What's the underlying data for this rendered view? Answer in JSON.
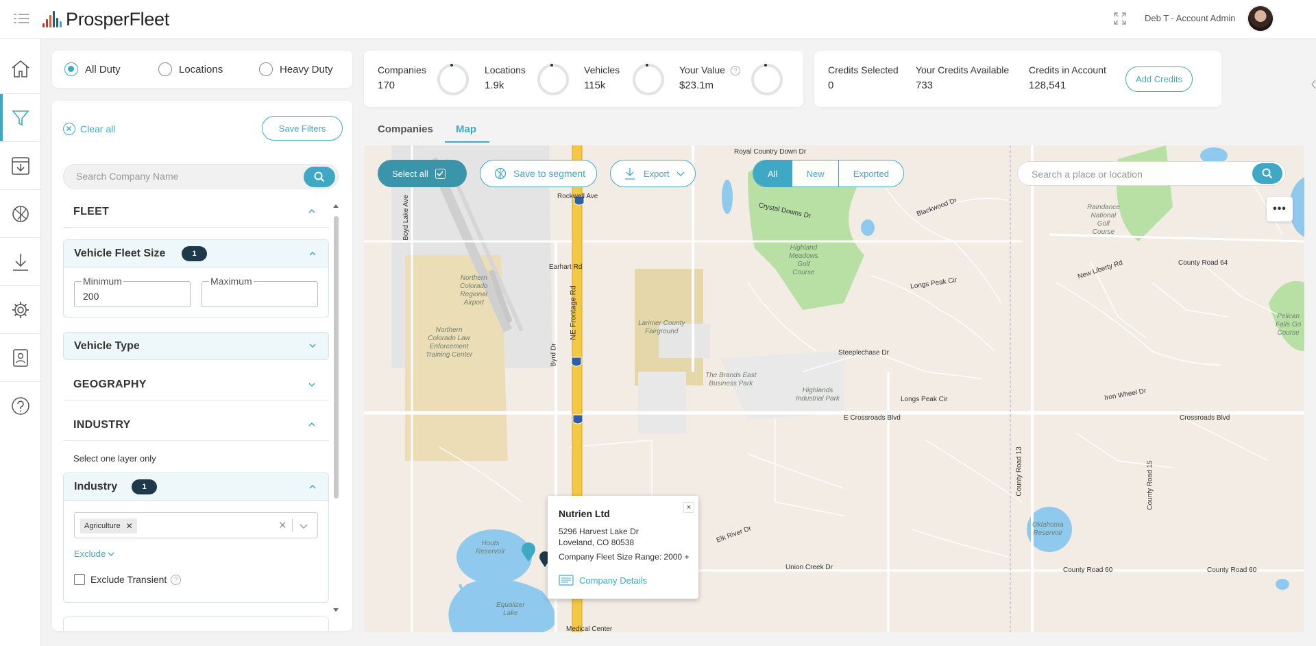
{
  "app": {
    "name": "ProsperFleet",
    "user": "Deb T - Account Admin"
  },
  "duty": {
    "options": [
      "All Duty",
      "Locations",
      "Heavy Duty"
    ],
    "selected": "All Duty"
  },
  "filters": {
    "clear_all": "Clear all",
    "save_filters": "Save Filters",
    "search_placeholder": "Search Company Name",
    "fleet": {
      "title": "FLEET",
      "vehicle_fleet_size": {
        "title": "Vehicle Fleet Size",
        "badge": "1",
        "min_label": "Minimum",
        "min_value": "200",
        "max_label": "Maximum",
        "max_value": ""
      },
      "vehicle_type": "Vehicle Type"
    },
    "geography": "GEOGRAPHY",
    "industry": {
      "title": "INDUSTRY",
      "hint": "Select one layer only",
      "sub_title": "Industry",
      "badge": "1",
      "chip": "Agriculture",
      "exclude": "Exclude",
      "exclude_transient": "Exclude Transient"
    }
  },
  "stats": {
    "companies": {
      "label": "Companies",
      "value": "170"
    },
    "locations": {
      "label": "Locations",
      "value": "1.9k"
    },
    "vehicles": {
      "label": "Vehicles",
      "value": "115k"
    },
    "your_value": {
      "label": "Your Value",
      "value": "$23.1m"
    }
  },
  "credits": {
    "selected": {
      "label": "Credits Selected",
      "value": "0"
    },
    "available": {
      "label": "Your Credits Available",
      "value": "733"
    },
    "account": {
      "label": "Credits in Account",
      "value": "128,541"
    },
    "add_button": "Add Credits"
  },
  "tabs": {
    "companies": "Companies",
    "map": "Map",
    "active": "Map"
  },
  "map": {
    "select_all": "Select all",
    "save_to_segment": "Save to segment",
    "export": "Export",
    "segments": [
      "All",
      "New",
      "Exported"
    ],
    "active_segment": "All",
    "place_placeholder": "Search a place or location",
    "more": "•••",
    "labels": {
      "royal_country_down": "Royal Country Down Dr",
      "rockwell": "Rockwell Ave",
      "crystal_downs": "Crystal Downs Dr",
      "blackwood": "Blackwood Dr",
      "earhart": "Earhart Rd",
      "ne_frontage": "NE Frontage Rd",
      "airport": "Northern\nColorado\nRegional\nAirport",
      "training": "Northern\nColorado Law\nEnforcement\nTraining Center",
      "fairground": "Larimer County\nFairground",
      "highland_golf": "Highland\nMeadows\nGolf\nCourse",
      "longs_peak_cir": "Longs Peak Cir",
      "steeplechase": "Steeplechase Dr",
      "brands": "The Brands East\nBusiness Park",
      "highlands_ind": "Highlands\nIndustrial Park",
      "longs_peak_cir2": "Longs Peak Cir",
      "crossroads": "E Crossroads Blvd",
      "crossroads2": "Crossroads Blvd",
      "raindance": "Raindance\nNational\nGolf\nCourse",
      "county_64": "County Road 64",
      "new_liberty": "New Liberty Rd",
      "iron_wheel": "Iron Wheel Dr",
      "houts": "Houts\nReservoir",
      "equalizer": "Equalizer\nLake",
      "elk_river": "Elk River Dr",
      "union_creek": "Union Creek Dr",
      "oklahoma": "Oklahoma\nReservoir",
      "county_60": "County Road 60",
      "county_60b": "County Road 60",
      "county_13": "County Road 13",
      "county_15": "County Road 15",
      "medical": "Medical Center",
      "boyd_lake": "Boyd Lake Ave",
      "earhart_short": "Byrd Dr",
      "pelican": "Pelican\nFalls Go\nCourse"
    },
    "popup": {
      "name": "Nutrien Ltd",
      "address1": "5296 Harvest Lake Dr",
      "address2": "Loveland, CO 80538",
      "fleet_range": "Company Fleet Size Range: 2000 +",
      "details": "Company Details",
      "close": "×"
    }
  },
  "colors": {
    "accent": "#3fa9c5",
    "badge": "#1e3a4a",
    "highway": "#f2c230"
  }
}
